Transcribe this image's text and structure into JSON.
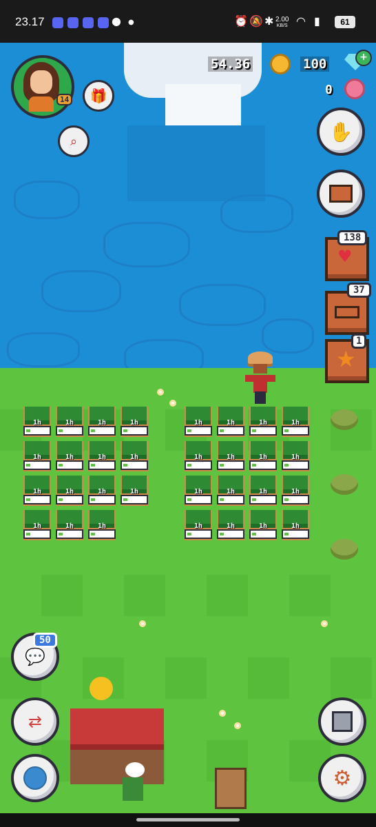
{
  "status_bar": {
    "time": "23.17",
    "network_speed": "2.00",
    "network_unit": "KB/S",
    "battery": "61",
    "notification_apps": [
      "discord-icon",
      "discord-icon",
      "discord-icon",
      "discord-icon",
      "chat-bubble-icon"
    ]
  },
  "hud": {
    "player_level": "14",
    "coins": "54.36",
    "gems": "100",
    "flowers": "0",
    "energy_count": "138",
    "bag_count": "37",
    "achievements_count": "1",
    "chat_count": "50"
  },
  "crops": {
    "timer_label": "1h",
    "left_field": {
      "rows": 4,
      "cols": 4,
      "empty_slots": [
        [
          3,
          3
        ]
      ]
    },
    "right_field": {
      "rows": 4,
      "cols": 4,
      "empty_slots": []
    }
  },
  "colors": {
    "water": "#1c8ed6",
    "grass": "#5ec43f",
    "crate": "#c9673a",
    "ui_outline": "#2c2c3a"
  }
}
